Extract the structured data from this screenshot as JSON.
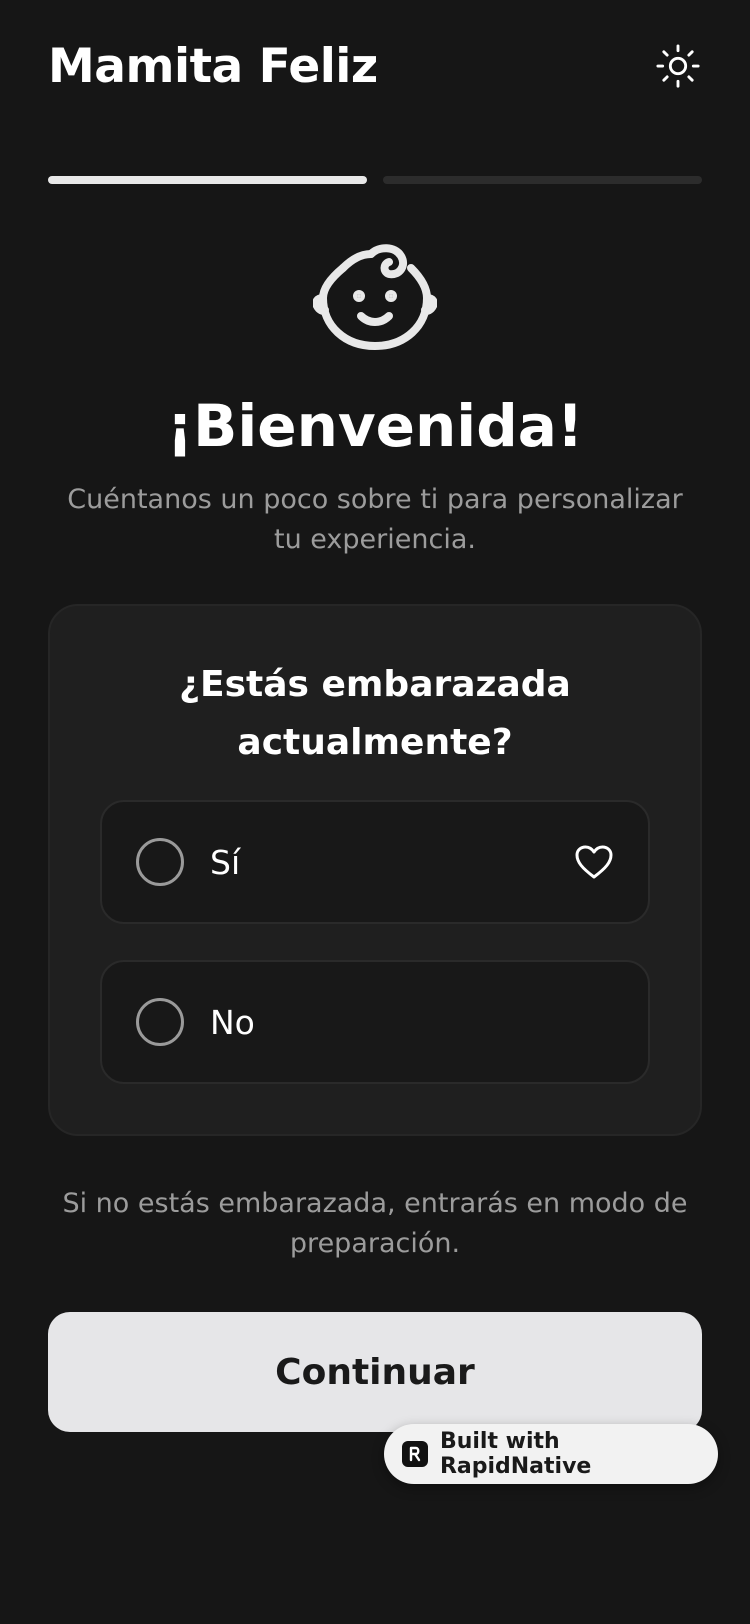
{
  "header": {
    "title": "Mamita Feliz",
    "theme_icon": "sun-icon"
  },
  "progress": {
    "steps_total": 2,
    "current_step": 1
  },
  "hero": {
    "icon": "baby-face-icon",
    "title": "¡Bienvenida!",
    "subtitle": "Cuéntanos un poco sobre ti para personalizar tu experiencia."
  },
  "question_card": {
    "question": "¿Estás embarazada actualmente?",
    "options": [
      {
        "label": "Sí",
        "icon": "heart-icon",
        "selected": false
      },
      {
        "label": "No",
        "selected": false
      }
    ]
  },
  "note": "Si no estás embarazada, entrarás en modo de preparación.",
  "continue_label": "Continuar",
  "badge": {
    "label": "Built with RapidNative",
    "icon": "rapidnative-logo-icon"
  },
  "colors": {
    "background": "#161616",
    "card": "#1f1f1f",
    "option": "#181818",
    "button": "#e6e6e8",
    "muted_text": "#9c9c9c"
  }
}
